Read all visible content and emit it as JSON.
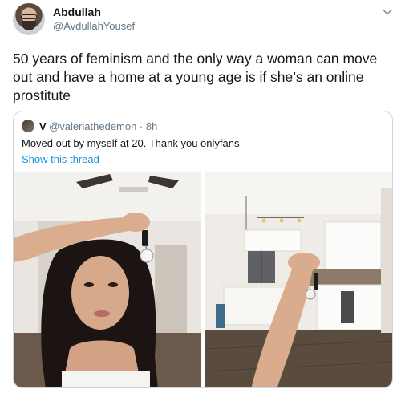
{
  "tweet": {
    "author": {
      "display_name": "Abdullah",
      "handle": "@AvdullahYousef"
    },
    "text": "50 years of feminism and the only way a woman can move out and have a home at a young age is if she’s an online prostitute",
    "quoted_tweet": {
      "author_name": "V",
      "author_handle_time": "@valeriathedemon · 8h",
      "text": "Moved out by myself at 20. Thank you onlyfans",
      "show_thread_label": "Show this thread",
      "photos": [
        {
          "description_icon": "photo-woman-holding-keys"
        },
        {
          "description_icon": "photo-kitchen-keys"
        }
      ]
    }
  },
  "icons": {
    "more_menu": "chevron-down-icon"
  },
  "colors": {
    "link_blue": "#1b95e0",
    "secondary_text": "#657786",
    "border": "#ccd6dd"
  }
}
